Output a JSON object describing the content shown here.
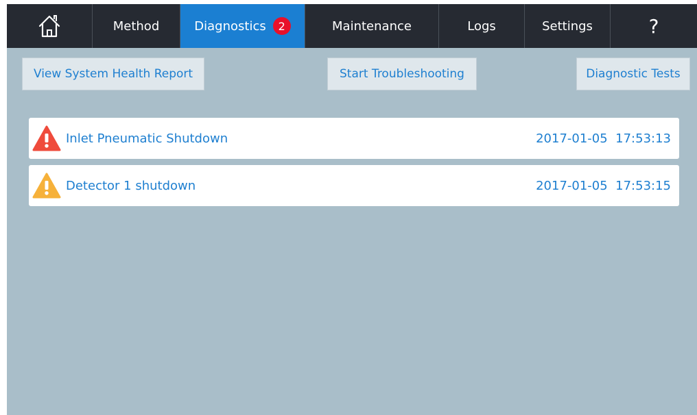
{
  "nav": {
    "home_icon": "home-icon",
    "tabs": [
      {
        "label": "Method"
      },
      {
        "label": "Diagnostics",
        "badge": "2",
        "active": true
      },
      {
        "label": "Maintenance"
      },
      {
        "label": "Logs"
      },
      {
        "label": "Settings"
      }
    ],
    "help_label": "?"
  },
  "actions": {
    "health_report": "View System Health Report",
    "troubleshoot": "Start Troubleshooting",
    "diagnostic_tests": "Diagnostic Tests"
  },
  "alarms": [
    {
      "icon": "error-warning-icon",
      "severity": "error",
      "message": "Inlet Pneumatic Shutdown",
      "timestamp": "2017-01-05  17:53:13"
    },
    {
      "icon": "caution-warning-icon",
      "severity": "warning",
      "message": "Detector 1 shutdown",
      "timestamp": "2017-01-05  17:53:15"
    }
  ],
  "colors": {
    "nav_bg": "#262a32",
    "active_tab": "#1b7fd2",
    "badge": "#e8102a",
    "content_bg": "#a9bec9",
    "link_text": "#1e7fd0",
    "error": "#ef4b3c",
    "warning": "#f6b13a"
  }
}
